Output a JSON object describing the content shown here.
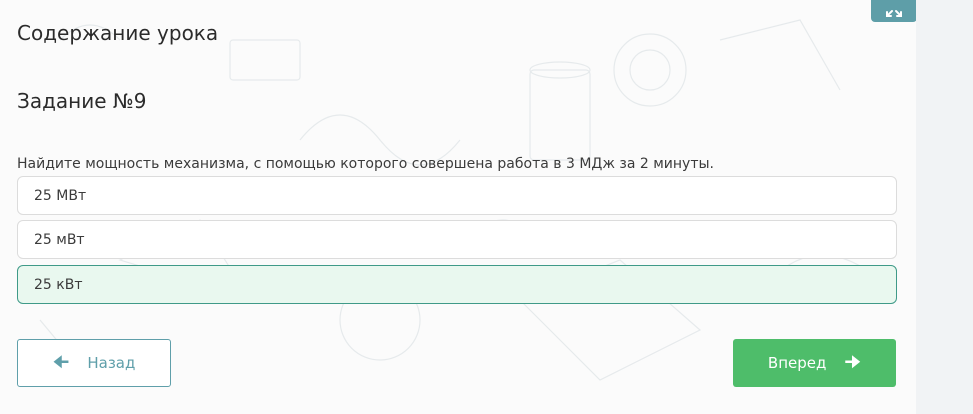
{
  "lesson": {
    "title": "Содержание урока"
  },
  "task": {
    "title": "Задание №9",
    "question": "Найдите мощность механизма, с помощью которого совершена работа в 3 МДж за 2 минуты.",
    "options": [
      {
        "label": "25 МВт",
        "selected": false
      },
      {
        "label": "25 мВт",
        "selected": false
      },
      {
        "label": "25 кВт",
        "selected": true
      }
    ]
  },
  "nav": {
    "back_label": "Назад",
    "next_label": "Вперед"
  },
  "colors": {
    "accent_teal": "#5f9faa",
    "next_green": "#4ebd6a",
    "selected_bg": "#e9f8ef",
    "selected_border": "#3f9a88"
  },
  "icons": {
    "expand": "expand-icon",
    "back": "arrow-left-icon",
    "next": "arrow-right-icon"
  }
}
